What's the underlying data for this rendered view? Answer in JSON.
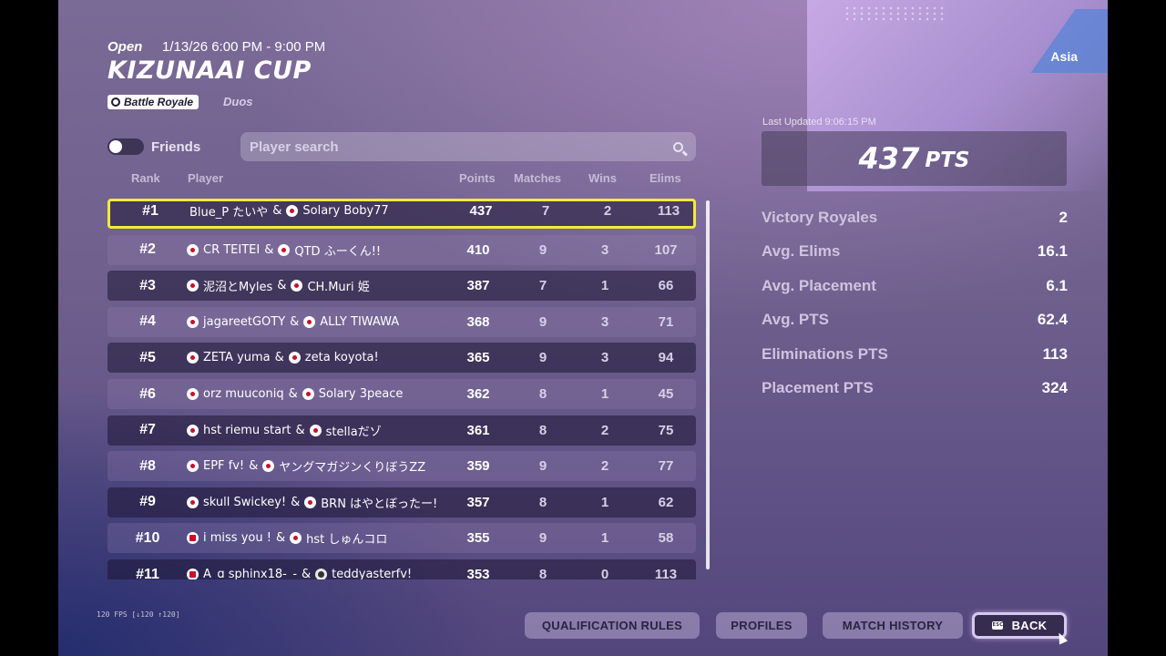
{
  "header": {
    "status": "Open",
    "time_range": "1/13/26 6:00 PM - 9:00 PM",
    "title": "KIZUNAAI CUP",
    "mode": "Battle Royale",
    "team_size": "Duos",
    "region": "Asia"
  },
  "filters": {
    "friends_label": "Friends",
    "friends_toggle": "off",
    "search_placeholder": "Player search"
  },
  "columns": {
    "rank": "Rank",
    "player": "Player",
    "points": "Points",
    "matches": "Matches",
    "wins": "Wins",
    "elims": "Elims"
  },
  "leaderboard": [
    {
      "rank": "#1",
      "p1": "Blue_P たいや",
      "p1_flag": "none",
      "p2": "Solary Boby77",
      "p2_flag": "jp",
      "points": "437",
      "matches": "7",
      "wins": "2",
      "elims": "113"
    },
    {
      "rank": "#2",
      "p1": "CR TEITEI",
      "p1_flag": "jp",
      "p2": "QTD ふーくん!!",
      "p2_flag": "jp",
      "points": "410",
      "matches": "9",
      "wins": "3",
      "elims": "107"
    },
    {
      "rank": "#3",
      "p1": "泥沼とMyles",
      "p1_flag": "jp",
      "p2": "CH.Muri 姫",
      "p2_flag": "jp",
      "points": "387",
      "matches": "7",
      "wins": "1",
      "elims": "66"
    },
    {
      "rank": "#4",
      "p1": "jagareetGOTY",
      "p1_flag": "jp",
      "p2": "ALLY TIWAWA",
      "p2_flag": "jp",
      "points": "368",
      "matches": "9",
      "wins": "3",
      "elims": "71"
    },
    {
      "rank": "#5",
      "p1": "ZETA yuma",
      "p1_flag": "jp",
      "p2": "zeta koyota!",
      "p2_flag": "jp",
      "points": "365",
      "matches": "9",
      "wins": "3",
      "elims": "94"
    },
    {
      "rank": "#6",
      "p1": "orz muuconiq",
      "p1_flag": "jp",
      "p2": "Solary 3peace",
      "p2_flag": "jp",
      "points": "362",
      "matches": "8",
      "wins": "1",
      "elims": "45"
    },
    {
      "rank": "#7",
      "p1": "hst riemu start",
      "p1_flag": "jp",
      "p2": "stellaだゾ",
      "p2_flag": "jp",
      "points": "361",
      "matches": "8",
      "wins": "2",
      "elims": "75"
    },
    {
      "rank": "#8",
      "p1": "EPF fv!",
      "p1_flag": "jp",
      "p2": "ヤングマガジンくりぼうZZ",
      "p2_flag": "jp",
      "points": "359",
      "matches": "9",
      "wins": "2",
      "elims": "77"
    },
    {
      "rank": "#9",
      "p1": "skull Swickey!",
      "p1_flag": "jp",
      "p2": "BRN はやとぼったー!",
      "p2_flag": "jp",
      "points": "357",
      "matches": "8",
      "wins": "1",
      "elims": "62"
    },
    {
      "rank": "#10",
      "p1": "i miss you !",
      "p1_flag": "ca",
      "p2": "hst しゅんコロ",
      "p2_flag": "jp",
      "points": "355",
      "matches": "9",
      "wins": "1",
      "elims": "58"
    },
    {
      "rank": "#11",
      "p1": "A_ɑ sphinx18-_-",
      "p1_flag": "ca",
      "p2": "teddyasterfv!",
      "p2_flag": "globe",
      "points": "353",
      "matches": "8",
      "wins": "0",
      "elims": "113"
    }
  ],
  "selected_team": {
    "last_updated": "Last Updated 9:06:15 PM",
    "total_points": "437",
    "points_unit": "PTS",
    "stats": [
      {
        "label": "Victory Royales",
        "value": "2"
      },
      {
        "label": "Avg. Elims",
        "value": "16.1"
      },
      {
        "label": "Avg. Placement",
        "value": "6.1"
      },
      {
        "label": "Avg. PTS",
        "value": "62.4"
      },
      {
        "label": "Eliminations PTS",
        "value": "113"
      },
      {
        "label": "Placement PTS",
        "value": "324"
      }
    ]
  },
  "footer": {
    "fps": "120 FPS [↓120 ↑120]",
    "buttons": [
      "QUALIFICATION RULES",
      "PROFILES",
      "MATCH HISTORY",
      "BACK"
    ]
  },
  "colors": {
    "selection_outline": "#f3ea3c",
    "background": "#6e5f8d",
    "row_dark": "#1e1634",
    "flag_red": "#c8102e"
  },
  "icons": {
    "search": "search-icon",
    "mode": "battle-royale-icon",
    "back_key": "esc-key-icon"
  }
}
